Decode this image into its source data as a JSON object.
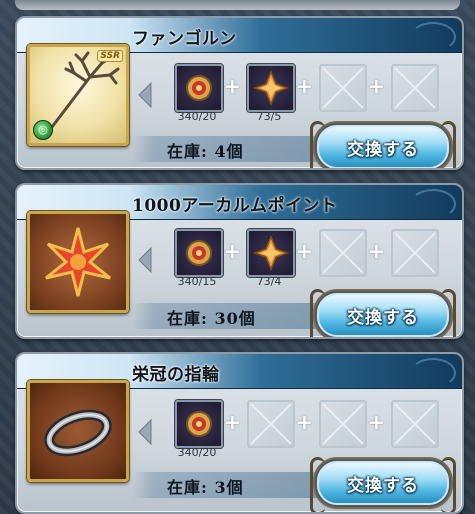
{
  "cards": [
    {
      "title": "ファンゴルン",
      "rarity": "SSR",
      "element_icon": "wind-element-icon",
      "materials": [
        {
          "state": "filled",
          "icon": "red-medallion-icon",
          "count": "340/20"
        },
        {
          "state": "filled",
          "icon": "gold-cross-crystal-icon",
          "count": "73/5"
        },
        {
          "state": "empty"
        },
        {
          "state": "empty"
        }
      ],
      "stock": "在庫: 4個",
      "button": "交換する"
    },
    {
      "title": "1000アーカルムポイント",
      "materials": [
        {
          "state": "filled",
          "icon": "red-medallion-icon",
          "count": "340/15"
        },
        {
          "state": "filled",
          "icon": "gold-cross-crystal-icon",
          "count": "73/4"
        },
        {
          "state": "empty"
        },
        {
          "state": "empty"
        }
      ],
      "stock": "在庫: 30個",
      "button": "交換する"
    },
    {
      "title": "栄冠の指輪",
      "materials": [
        {
          "state": "filled",
          "icon": "red-medallion-icon",
          "count": "340/20"
        },
        {
          "state": "empty"
        },
        {
          "state": "empty"
        },
        {
          "state": "empty"
        }
      ],
      "stock": "在庫: 3個",
      "button": "交換する"
    }
  ]
}
